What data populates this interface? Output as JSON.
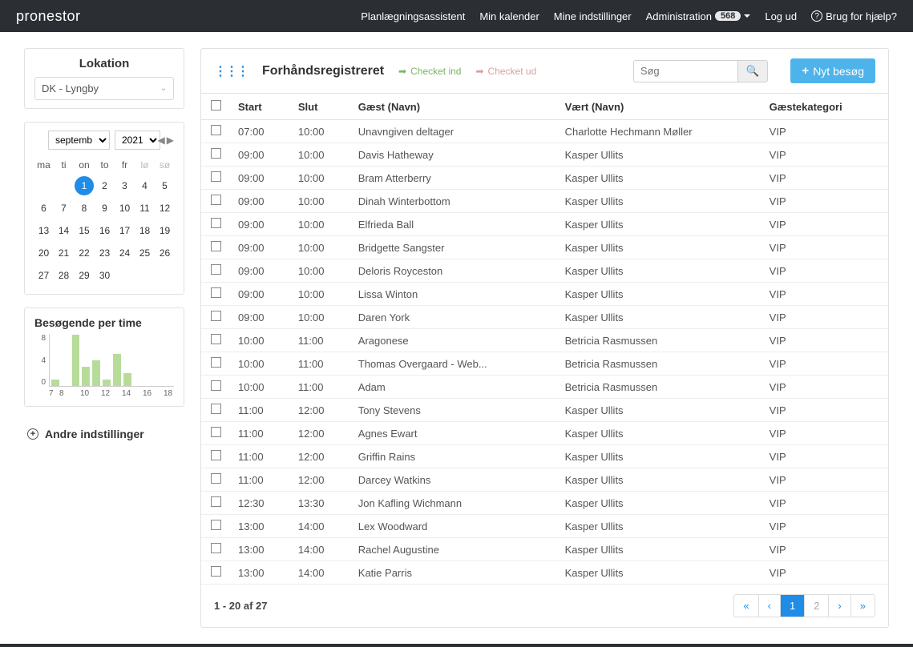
{
  "brand": {
    "pro": "pro",
    "nestor": "nestor"
  },
  "nav": {
    "planning": "Planlægningsassistent",
    "calendar": "Min kalender",
    "settings": "Mine indstillinger",
    "admin": "Administration",
    "admin_badge": "568",
    "logout": "Log ud",
    "help": "Brug for hjælp?"
  },
  "location": {
    "title": "Lokation",
    "selected": "DK - Lyngby"
  },
  "calendar": {
    "month": "septemb",
    "year": "2021",
    "dow": [
      "ma",
      "ti",
      "on",
      "to",
      "fr",
      "lø",
      "sø"
    ],
    "days": [
      [
        "",
        "",
        "1",
        "2",
        "3",
        "4",
        "5"
      ],
      [
        "6",
        "7",
        "8",
        "9",
        "10",
        "11",
        "12"
      ],
      [
        "13",
        "14",
        "15",
        "16",
        "17",
        "18",
        "19"
      ],
      [
        "20",
        "21",
        "22",
        "23",
        "24",
        "25",
        "26"
      ],
      [
        "27",
        "28",
        "29",
        "30",
        "",
        "",
        ""
      ]
    ],
    "selected_day": "1"
  },
  "chart_title": "Besøgende per time",
  "chart_data": {
    "type": "bar",
    "categories": [
      "7",
      "8",
      "9",
      "10",
      "11",
      "12",
      "13",
      "14",
      "15",
      "16",
      "17",
      "18"
    ],
    "values": [
      1,
      0,
      8,
      3,
      4,
      1,
      5,
      2,
      0,
      0,
      0,
      0
    ],
    "title": "Besøgende per time",
    "xlabel": "",
    "ylabel": "",
    "ylim": [
      0,
      8
    ],
    "yticks": [
      8,
      4,
      0
    ],
    "xticks": [
      "7",
      "8",
      "",
      "10",
      "",
      "12",
      "",
      "14",
      "",
      "16",
      "",
      "18"
    ]
  },
  "other_settings": "Andre indstillinger",
  "main": {
    "title": "Forhåndsregistreret",
    "check_in": "Checket ind",
    "check_out": "Checket ud",
    "search_placeholder": "Søg",
    "new_visit": "Nyt besøg",
    "columns": [
      "Start",
      "Slut",
      "Gæst (Navn)",
      "Vært (Navn)",
      "Gæstekategori"
    ],
    "rows": [
      {
        "start": "07:00",
        "slut": "10:00",
        "guest": "Unavngiven deltager",
        "host": "Charlotte Hechmann Møller",
        "cat": "VIP"
      },
      {
        "start": "09:00",
        "slut": "10:00",
        "guest": "Davis Hatheway",
        "host": "Kasper Ullits",
        "cat": "VIP"
      },
      {
        "start": "09:00",
        "slut": "10:00",
        "guest": "Bram Atterberry",
        "host": "Kasper Ullits",
        "cat": "VIP"
      },
      {
        "start": "09:00",
        "slut": "10:00",
        "guest": "Dinah Winterbottom",
        "host": "Kasper Ullits",
        "cat": "VIP"
      },
      {
        "start": "09:00",
        "slut": "10:00",
        "guest": "Elfrieda Ball",
        "host": "Kasper Ullits",
        "cat": "VIP"
      },
      {
        "start": "09:00",
        "slut": "10:00",
        "guest": "Bridgette Sangster",
        "host": "Kasper Ullits",
        "cat": "VIP"
      },
      {
        "start": "09:00",
        "slut": "10:00",
        "guest": "Deloris Royceston",
        "host": "Kasper Ullits",
        "cat": "VIP"
      },
      {
        "start": "09:00",
        "slut": "10:00",
        "guest": "Lissa Winton",
        "host": "Kasper Ullits",
        "cat": "VIP"
      },
      {
        "start": "09:00",
        "slut": "10:00",
        "guest": "Daren York",
        "host": "Kasper Ullits",
        "cat": "VIP"
      },
      {
        "start": "10:00",
        "slut": "11:00",
        "guest": "Aragonese",
        "host": "Betricia Rasmussen",
        "cat": "VIP"
      },
      {
        "start": "10:00",
        "slut": "11:00",
        "guest": "Thomas Overgaard - Web...",
        "host": "Betricia Rasmussen",
        "cat": "VIP"
      },
      {
        "start": "10:00",
        "slut": "11:00",
        "guest": "Adam",
        "host": "Betricia Rasmussen",
        "cat": "VIP"
      },
      {
        "start": "11:00",
        "slut": "12:00",
        "guest": "Tony Stevens",
        "host": "Kasper Ullits",
        "cat": "VIP"
      },
      {
        "start": "11:00",
        "slut": "12:00",
        "guest": "Agnes Ewart",
        "host": "Kasper Ullits",
        "cat": "VIP"
      },
      {
        "start": "11:00",
        "slut": "12:00",
        "guest": "Griffin Rains",
        "host": "Kasper Ullits",
        "cat": "VIP"
      },
      {
        "start": "11:00",
        "slut": "12:00",
        "guest": "Darcey Watkins",
        "host": "Kasper Ullits",
        "cat": "VIP"
      },
      {
        "start": "12:30",
        "slut": "13:30",
        "guest": "Jon Kafling Wichmann",
        "host": "Kasper Ullits",
        "cat": "VIP"
      },
      {
        "start": "13:00",
        "slut": "14:00",
        "guest": "Lex Woodward",
        "host": "Kasper Ullits",
        "cat": "VIP"
      },
      {
        "start": "13:00",
        "slut": "14:00",
        "guest": "Rachel Augustine",
        "host": "Kasper Ullits",
        "cat": "VIP"
      },
      {
        "start": "13:00",
        "slut": "14:00",
        "guest": "Katie Parris",
        "host": "Kasper Ullits",
        "cat": "VIP"
      }
    ],
    "page_info": "1 - 20 af 27",
    "pages": [
      "1",
      "2"
    ],
    "current_page": "1"
  }
}
